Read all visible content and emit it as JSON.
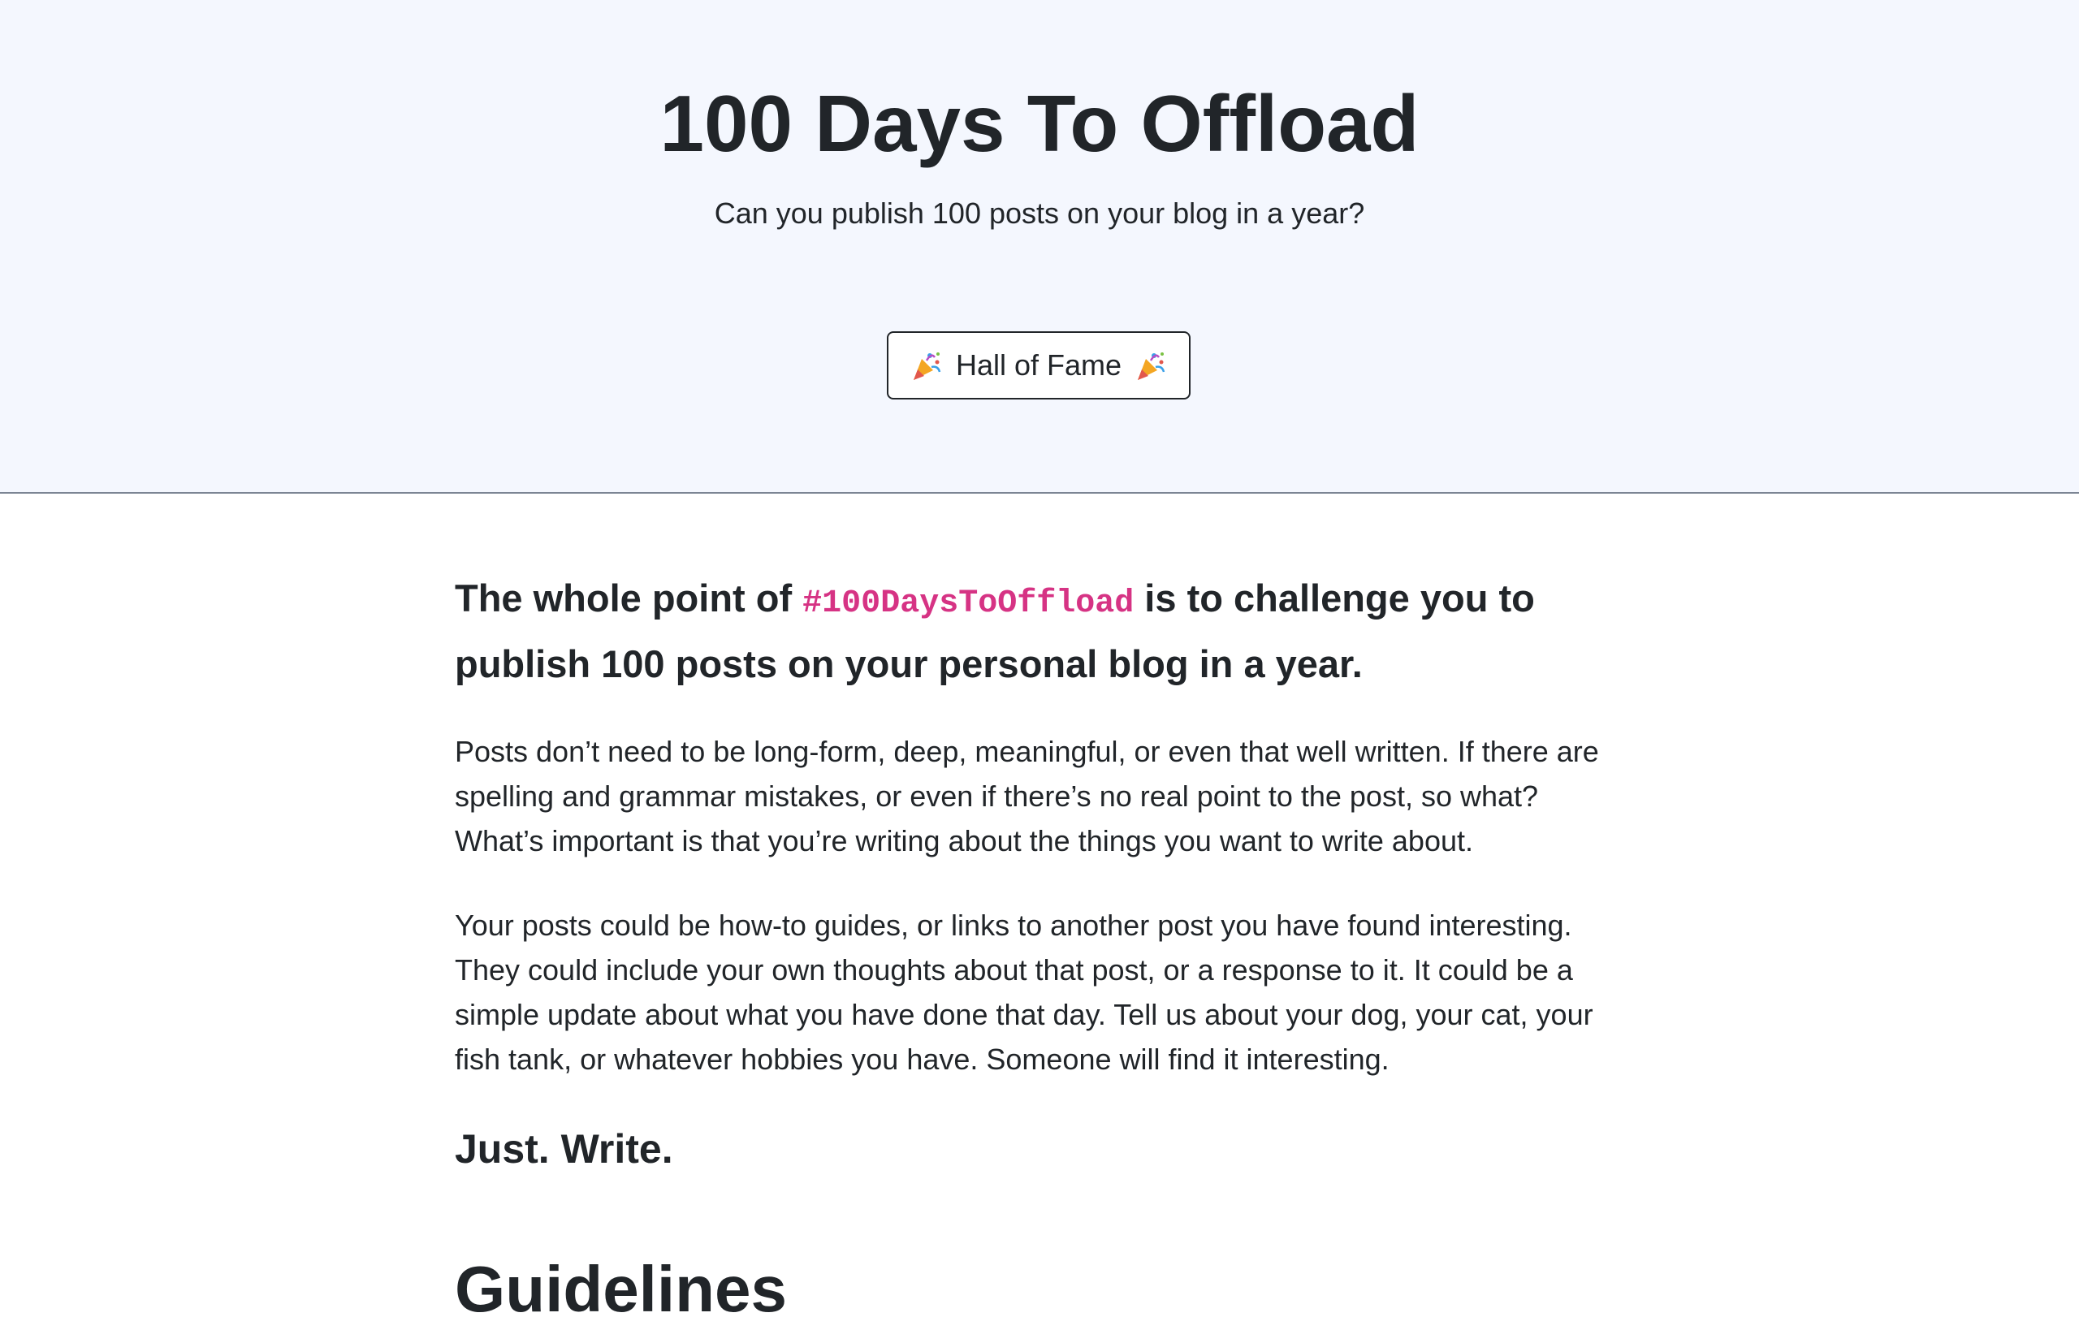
{
  "hero": {
    "title": "100 Days To Offload",
    "subtitle": "Can you publish 100 posts on your blog in a year?",
    "button_label": "Hall of Fame",
    "button_icon": "party-popper-icon"
  },
  "main": {
    "lead_prefix": "The whole point of ",
    "lead_hashtag": "#100DaysToOffload",
    "lead_suffix": " is to challenge you to publish 100 posts on your personal blog in a year.",
    "paragraph_1": "Posts don’t need to be long-form, deep, meaningful, or even that well written. If there are spelling and grammar mistakes, or even if there’s no real point to the post, so what? What’s important is that you’re writing about the things you want to write about.",
    "paragraph_2": "Your posts could be how-to guides, or links to another post you have found interesting. They could include your own thoughts about that post, or a response to it. It could be a simple update about what you have done that day. Tell us about your dog, your cat, your fish tank, or whatever hobbies you have. Someone will find it interesting.",
    "emphasis": "Just. Write.",
    "section_heading": "Guidelines"
  },
  "colors": {
    "hero_background": "#f4f7fe",
    "text": "#212529",
    "hashtag": "#d63384",
    "divider": "#7c8594"
  }
}
